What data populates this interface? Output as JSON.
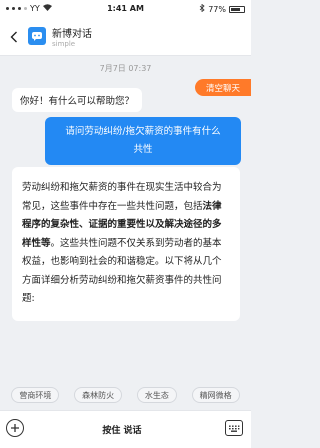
{
  "status_bar": {
    "carrier": "YY",
    "time": "1:41 AM",
    "battery_text": "77%",
    "battery_level": 0.77
  },
  "header": {
    "title": "新博对话",
    "subtitle": "simple",
    "back_icon": "chevron-left-icon",
    "avatar_icon": "chat-bot-icon"
  },
  "chat": {
    "timestamp": "7月7日 07:37",
    "greeting": "你好！有什么可以帮助您？",
    "clear_label": "清空聊天",
    "user_message_line1": "请问劳动纠纷/拖欠薪资的事件有什么",
    "user_message_line2": "共性",
    "answer": {
      "part1": "劳动纠纷和拖欠薪资的事件在现实生活中较合为常见，这些事件中存在一些共性问题，包括",
      "bold1": "法律程序的复杂性、证据的重要性以及解决途径的多样性等",
      "part2": "。这些共性问题不仅关系到劳动者的基本权益，也影响到社会的和谐稳定。以下将从几个方面详细分析劳动纠纷和拖欠薪资事件的共性问题:"
    }
  },
  "chips": [
    "营商环境",
    "森林防火",
    "水生态",
    "精网微格"
  ],
  "input_bar": {
    "voice_label": "按住 说话",
    "add_icon": "plus-circle-icon",
    "keyboard_icon": "keyboard-icon"
  },
  "colors": {
    "accent_blue": "#2389f3",
    "clear_orange": "#ff7a29",
    "background": "#eef0f3"
  }
}
